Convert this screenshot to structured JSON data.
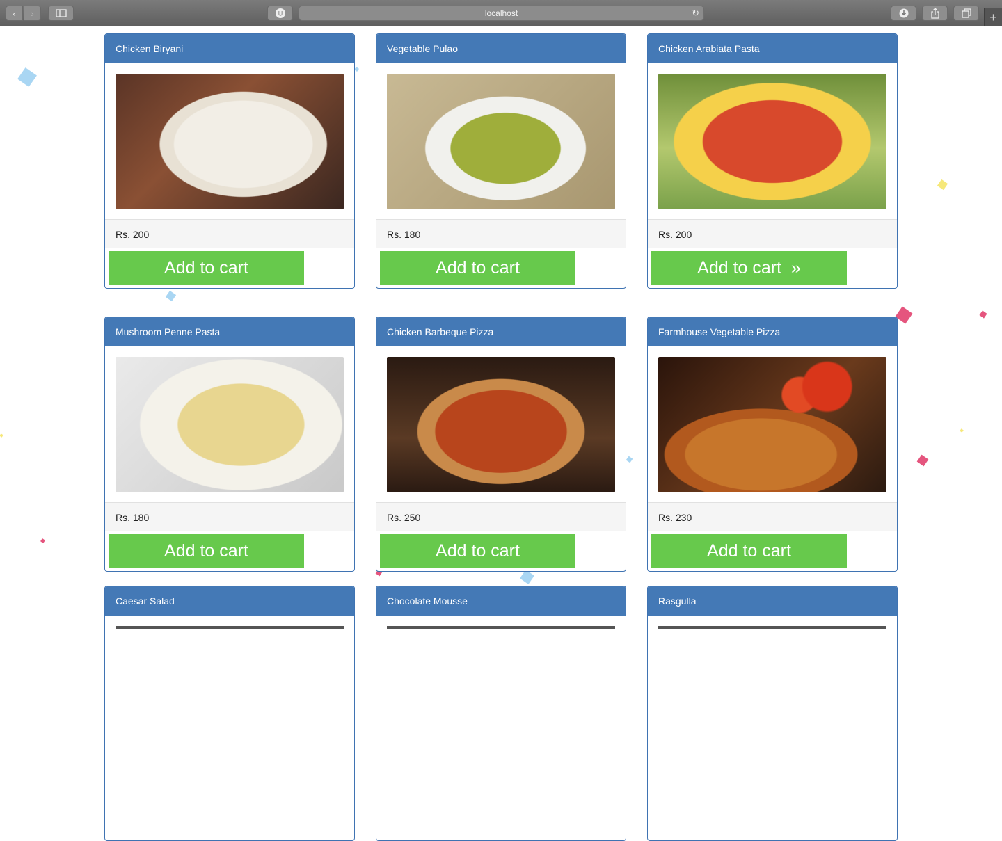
{
  "browser": {
    "url": "localhost"
  },
  "products": [
    {
      "name": "Chicken Biryani",
      "price": "Rs. 200",
      "button": "Add to cart",
      "image": "chicken-biryani-photo"
    },
    {
      "name": "Vegetable Pulao",
      "price": "Rs. 180",
      "button": "Add to cart",
      "image": "vegetable-pulao-photo"
    },
    {
      "name": "Chicken Arabiata Pasta",
      "price": "Rs. 200",
      "button": "Add to cart  »",
      "image": "chicken-arabiata-pasta-photo"
    },
    {
      "name": "Mushroom Penne Pasta",
      "price": "Rs. 180",
      "button": "Add to cart",
      "image": "mushroom-penne-pasta-photo"
    },
    {
      "name": "Chicken Barbeque Pizza",
      "price": "Rs. 250",
      "button": "Add to cart",
      "image": "chicken-barbeque-pizza-photo"
    },
    {
      "name": "Farmhouse Vegetable Pizza",
      "price": "Rs. 230",
      "button": "Add to cart",
      "image": "farmhouse-vegetable-pizza-photo"
    },
    {
      "name": "Caesar Salad"
    },
    {
      "name": "Chocolate Mousse"
    },
    {
      "name": "Rasgulla"
    }
  ],
  "colors": {
    "header_blue": "#4479b6",
    "button_green": "#67c94c",
    "footer_gray": "#f5f5f5"
  }
}
